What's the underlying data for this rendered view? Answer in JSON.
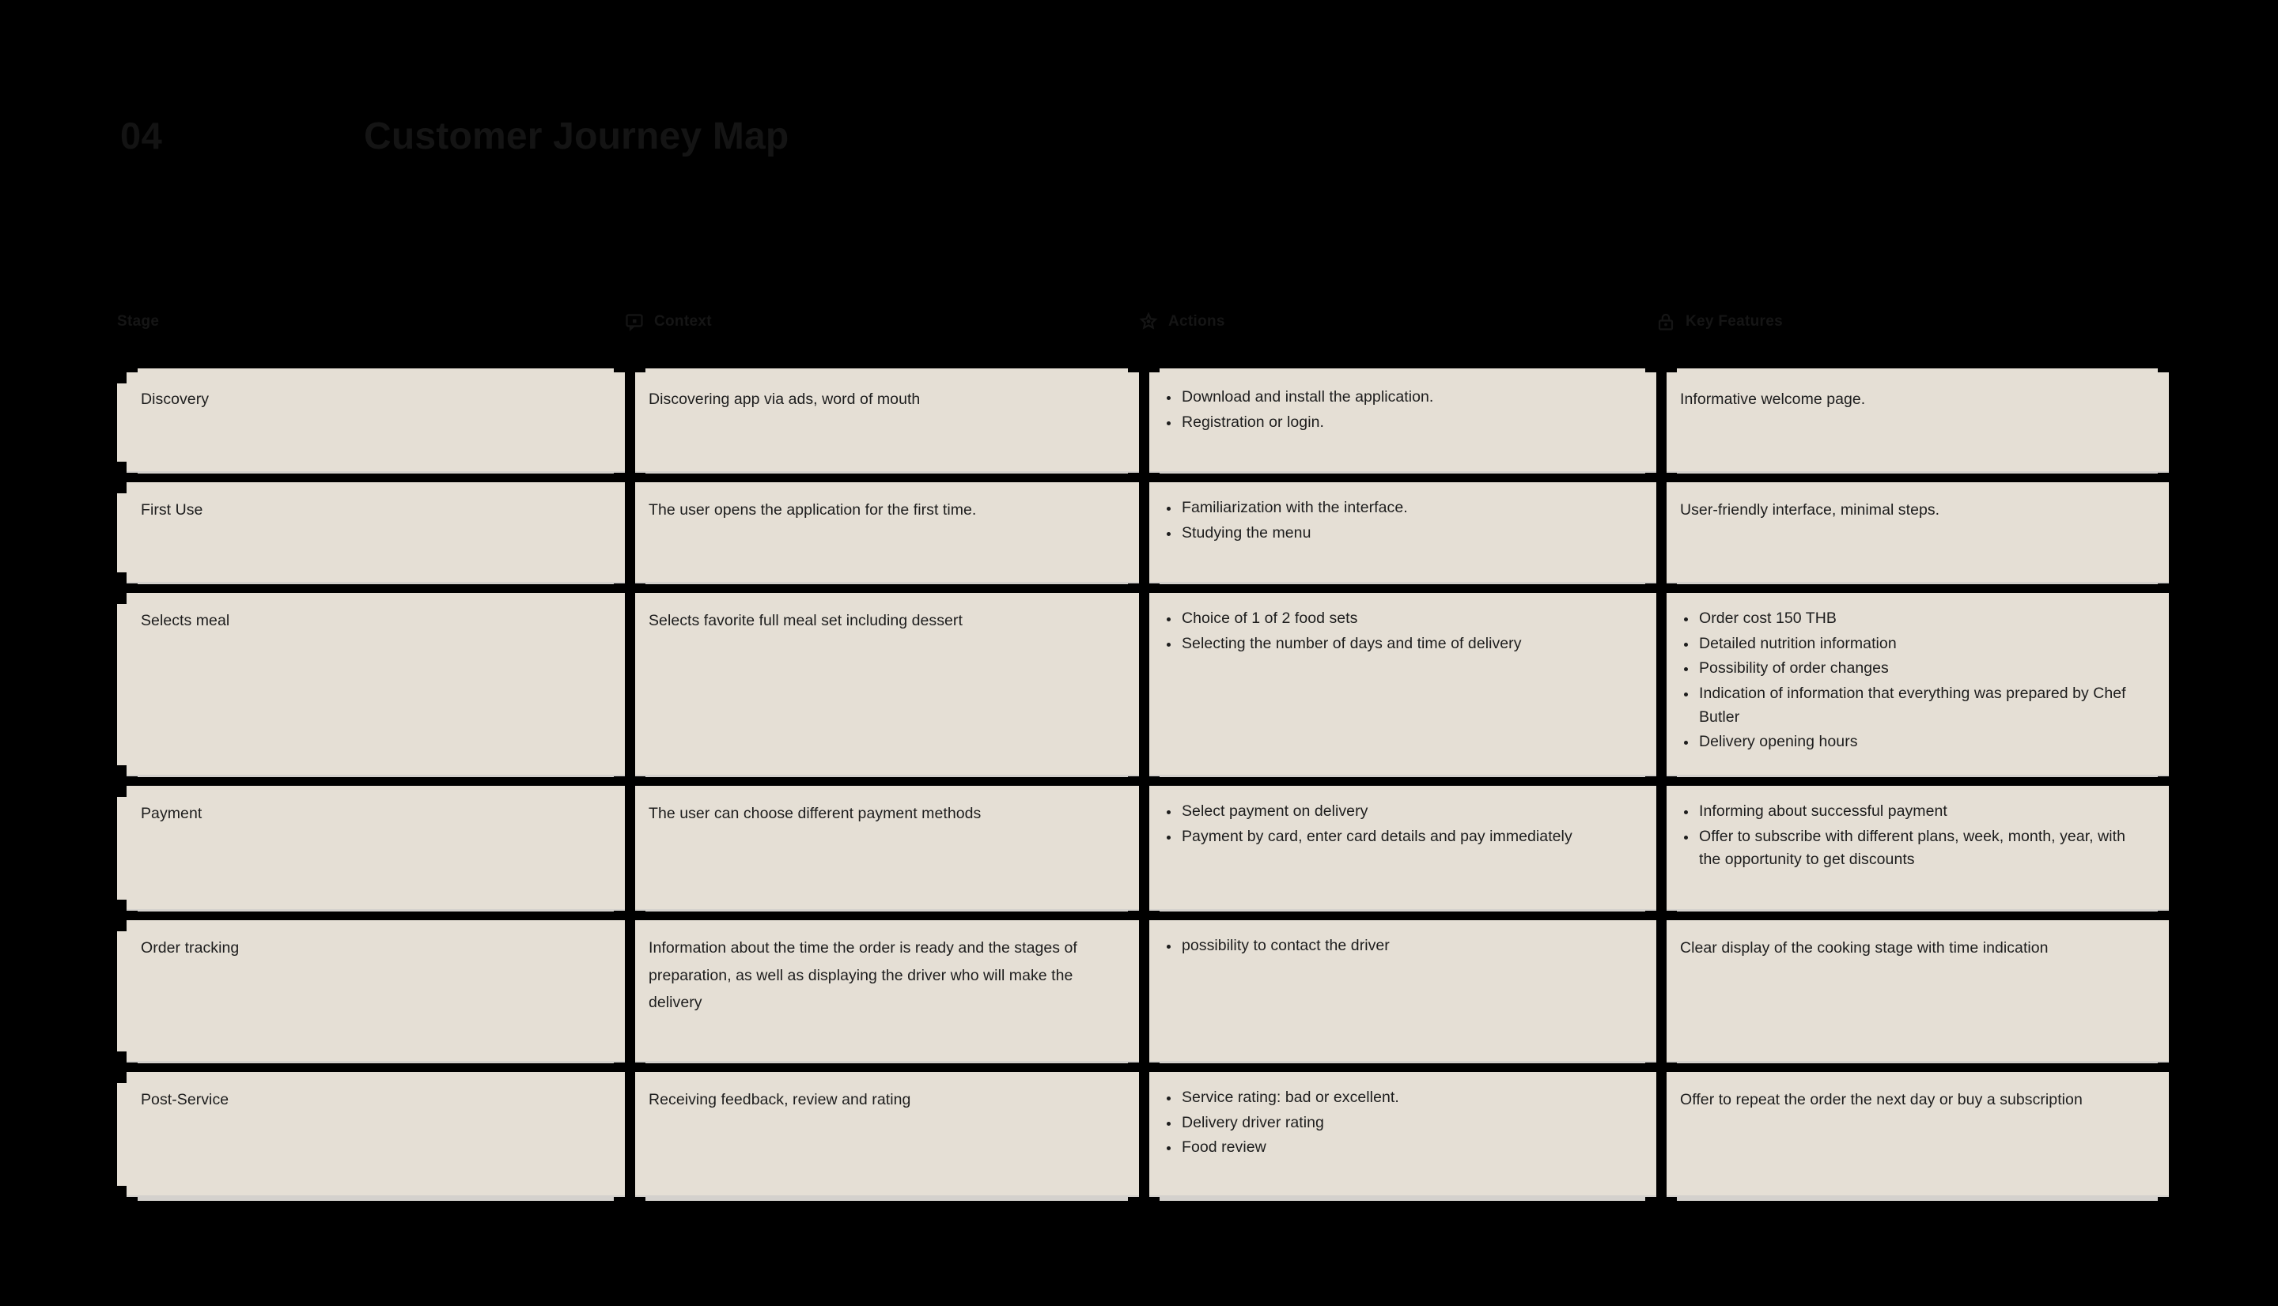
{
  "slide": {
    "number": "04",
    "title": "Customer Journey Map",
    "background_color": "#000000",
    "cell_color": "#e5dfd5",
    "text_color": "#1d1d1d"
  },
  "columns": [
    {
      "id": "stage",
      "label": "Stage",
      "icon": ""
    },
    {
      "id": "context",
      "label": "Context",
      "icon": "chat-bubble-icon"
    },
    {
      "id": "actions",
      "label": "Actions",
      "icon": "star-gear-icon"
    },
    {
      "id": "key_features",
      "label": "Key Features",
      "icon": "lock-icon"
    }
  ],
  "rows": [
    {
      "stage": "Discovery",
      "context": "Discovering app via ads, word of mouth",
      "actions": [
        "Download and install the application.",
        "Registration or login."
      ],
      "key_features": "Informative welcome page."
    },
    {
      "stage": "First Use",
      "context": "The user opens the application for the first time.",
      "actions": [
        "Familiarization with the interface.",
        "Studying the menu"
      ],
      "key_features": "User-friendly interface, minimal steps."
    },
    {
      "stage": "Selects meal",
      "context": "Selects favorite full meal set including dessert",
      "actions": [
        "Choice of 1 of 2 food sets",
        "Selecting the number of days and time of delivery"
      ],
      "key_features": [
        "Order cost 150 THB",
        "Detailed nutrition information",
        "Possibility of order changes",
        "Indication of information that everything was prepared by Chef Butler",
        "Delivery opening hours"
      ]
    },
    {
      "stage": "Payment",
      "context": "The user can choose different payment methods",
      "actions": [
        "Select payment on delivery",
        "Payment by card, enter card details and pay immediately"
      ],
      "key_features": [
        "Informing about successful payment",
        "Offer to subscribe with different plans, week, month, year, with the opportunity to get discounts"
      ]
    },
    {
      "stage": "Order tracking",
      "context": "Information about the time the order is ready and the stages of preparation, as well as displaying the driver who will make the delivery",
      "actions": [
        "possibility to contact the driver"
      ],
      "key_features": "Clear display of the cooking stage with time indication"
    },
    {
      "stage": "Post-Service",
      "context": "Receiving feedback, review and rating",
      "actions": [
        "Service rating: bad or excellent.",
        "Delivery driver rating",
        "Food review"
      ],
      "key_features": "Offer to repeat the order the next day or buy a subscription"
    }
  ]
}
